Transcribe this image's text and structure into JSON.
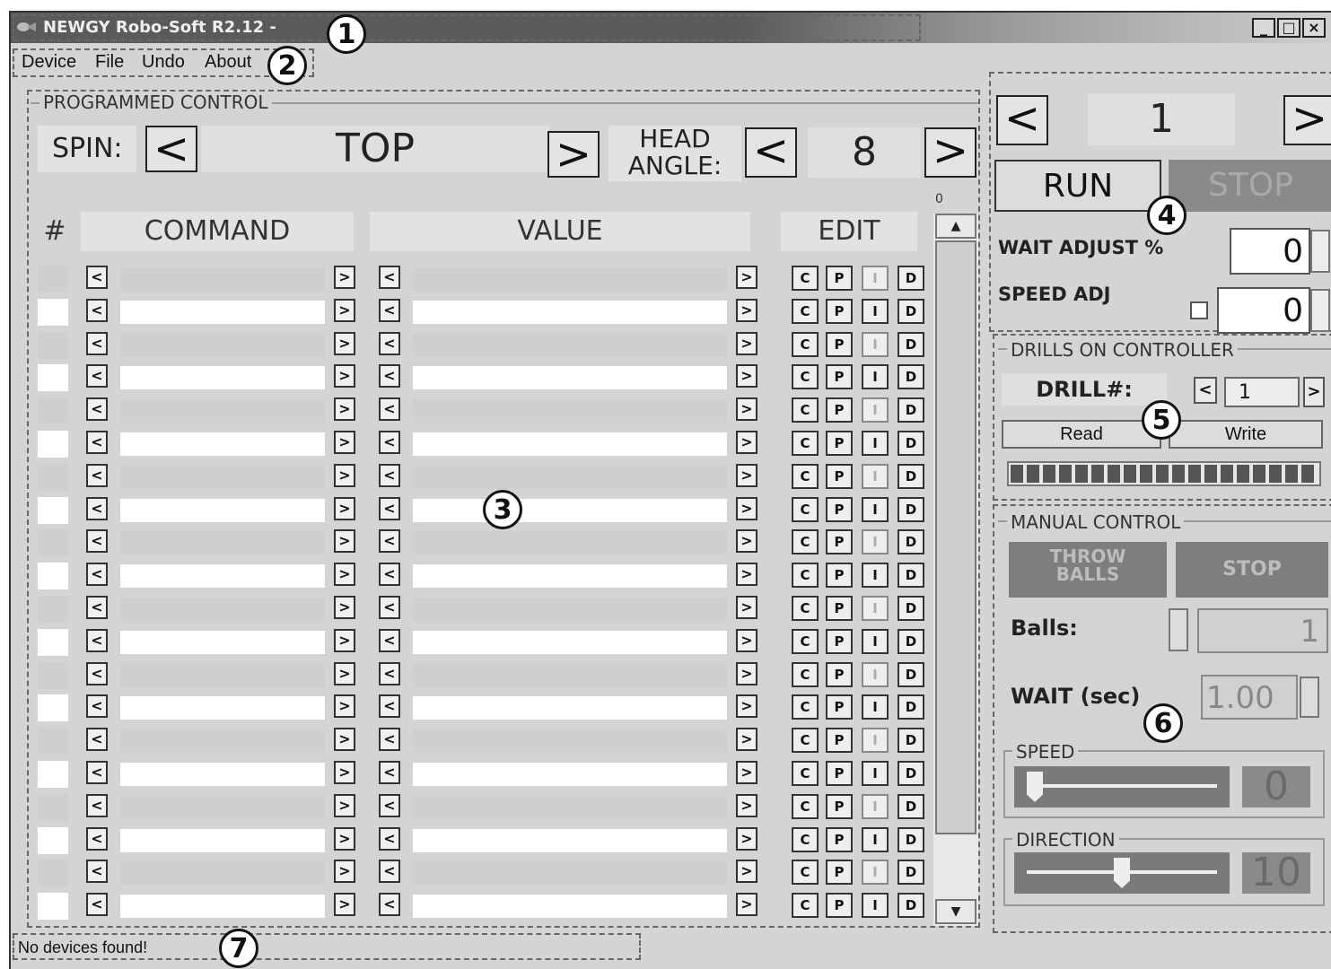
{
  "window": {
    "title": "NEWGY Robo-Soft R2.12 -",
    "controls": {
      "minimize": "_",
      "maximize": "□",
      "close": "×"
    }
  },
  "menu": {
    "items": [
      "Device",
      "File",
      "Undo",
      "About"
    ]
  },
  "callouts": [
    "1",
    "2",
    "3",
    "4",
    "5",
    "6",
    "7"
  ],
  "programmed_control": {
    "label": "PROGRAMMED CONTROL",
    "spin_label": "SPIN:",
    "spin_value": "TOP",
    "head_angle_label_line1": "HEAD",
    "head_angle_label_line2": "ANGLE:",
    "head_angle_value": "8",
    "prev": "<",
    "next": ">",
    "scroll_top_value": "0",
    "table": {
      "headers": {
        "num": "#",
        "command": "COMMAND",
        "value": "VALUE",
        "edit": "EDIT"
      },
      "arrow_left": "<",
      "arrow_right": ">",
      "edit_buttons": [
        "C",
        "P",
        "I",
        "D"
      ],
      "row_count": 20
    },
    "scroll_up": "▲",
    "scroll_down": "▼"
  },
  "drill_nav": {
    "prev": "<",
    "next": ">",
    "value": "1",
    "run": "RUN",
    "stop": "STOP",
    "wait_adjust_label": "WAIT ADJUST %",
    "wait_adjust_value": "0",
    "speed_adj_label": "SPEED ADJ",
    "speed_adj_value": "0"
  },
  "drills_on_controller": {
    "label": "DRILLS ON CONTROLLER",
    "drill_label": "DRILL#:",
    "drill_value": "1",
    "prev": "<",
    "next": ">",
    "read": "Read",
    "write": "Write",
    "progress": 1.0
  },
  "manual_control": {
    "label": "MANUAL CONTROL",
    "throw_line1": "THROW",
    "throw_line2": "BALLS",
    "stop": "STOP",
    "balls_label": "Balls:",
    "balls_value": "1",
    "wait_label": "WAIT (sec)",
    "wait_value": "1.00",
    "speed_label": "SPEED",
    "speed_value": "0",
    "speed_level": 0.0,
    "direction_label": "DIRECTION",
    "direction_value": "10",
    "direction_level": 0.5
  },
  "status": {
    "text": "No devices found!"
  }
}
